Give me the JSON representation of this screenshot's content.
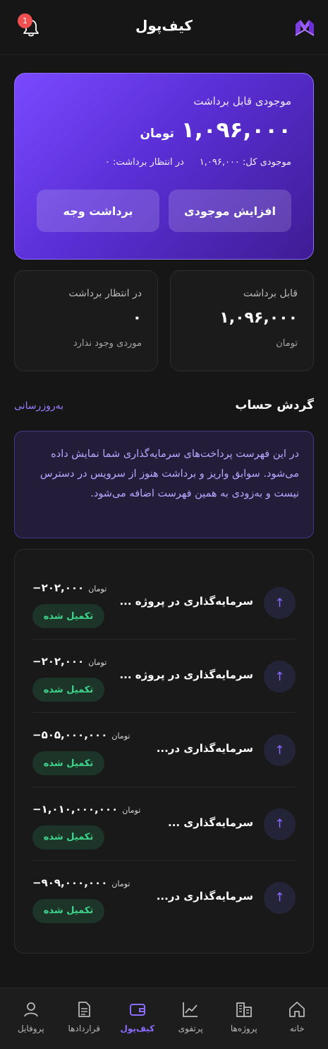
{
  "header": {
    "title": "کیف‌پول",
    "notification_count": "1",
    "notification_icon": "bell-icon",
    "logo_icon": "brand-logo"
  },
  "balance": {
    "label": "موجودی قابل برداشت",
    "amount": "۱,۰۹۶,۰۰۰",
    "unit": "تومان",
    "total_text": "موجودی کل: ۱,۰۹۶,۰۰۰",
    "pending_text": "در انتظار برداشت: ۰",
    "increase_button": "افزایش موجودی",
    "withdraw_button": "برداشت وجه"
  },
  "stats": {
    "available": {
      "label": "قابل برداشت",
      "value": "۱,۰۹۶,۰۰۰",
      "note": "تومان"
    },
    "pending": {
      "label": "در انتظار برداشت",
      "value": "۰",
      "note": "موردی وجود ندارد"
    }
  },
  "transactions_section": {
    "title": "گردش حساب",
    "refresh": "به‌روزرسانی",
    "info": "در این فهرست پرداخت‌های سرمایه‌گذاری شما نمایش داده می‌شود. سوابق واریز و برداشت هنوز از سرویس در دسترس نیست و به‌زودی به همین فهرست اضافه می‌شود."
  },
  "transactions": [
    {
      "title": "سرمایه‌گذاری در پروژه ...",
      "amount": "۲۰۲,۰۰۰−",
      "unit": "تومان",
      "status": "تکمیل شده"
    },
    {
      "title": "سرمایه‌گذاری در پروژه ...",
      "amount": "۲۰۲,۰۰۰−",
      "unit": "تومان",
      "status": "تکمیل شده"
    },
    {
      "title": "سرمایه‌گذاری در...",
      "amount": "۵۰۵,۰۰۰,۰۰۰−",
      "unit": "تومان",
      "status": "تکمیل شده"
    },
    {
      "title": "سرمایه‌گذاری ...",
      "amount": "۱,۰۱۰,۰۰۰,۰۰۰−",
      "unit": "تومان",
      "status": "تکمیل شده"
    },
    {
      "title": "سرمایه‌گذاری در...",
      "amount": "۹۰۹,۰۰۰,۰۰۰−",
      "unit": "تومان",
      "status": "تکمیل شده"
    }
  ],
  "nav": {
    "home": "خانه",
    "projects": "پروژه‌ها",
    "portfolio": "پرتفوی",
    "wallet": "کیف‌پول",
    "contracts": "قراردادها",
    "profile": "پروفایل"
  },
  "colors": {
    "accent": "#8c6bff",
    "success": "#3dd68c",
    "badge": "#ef4f4f"
  }
}
